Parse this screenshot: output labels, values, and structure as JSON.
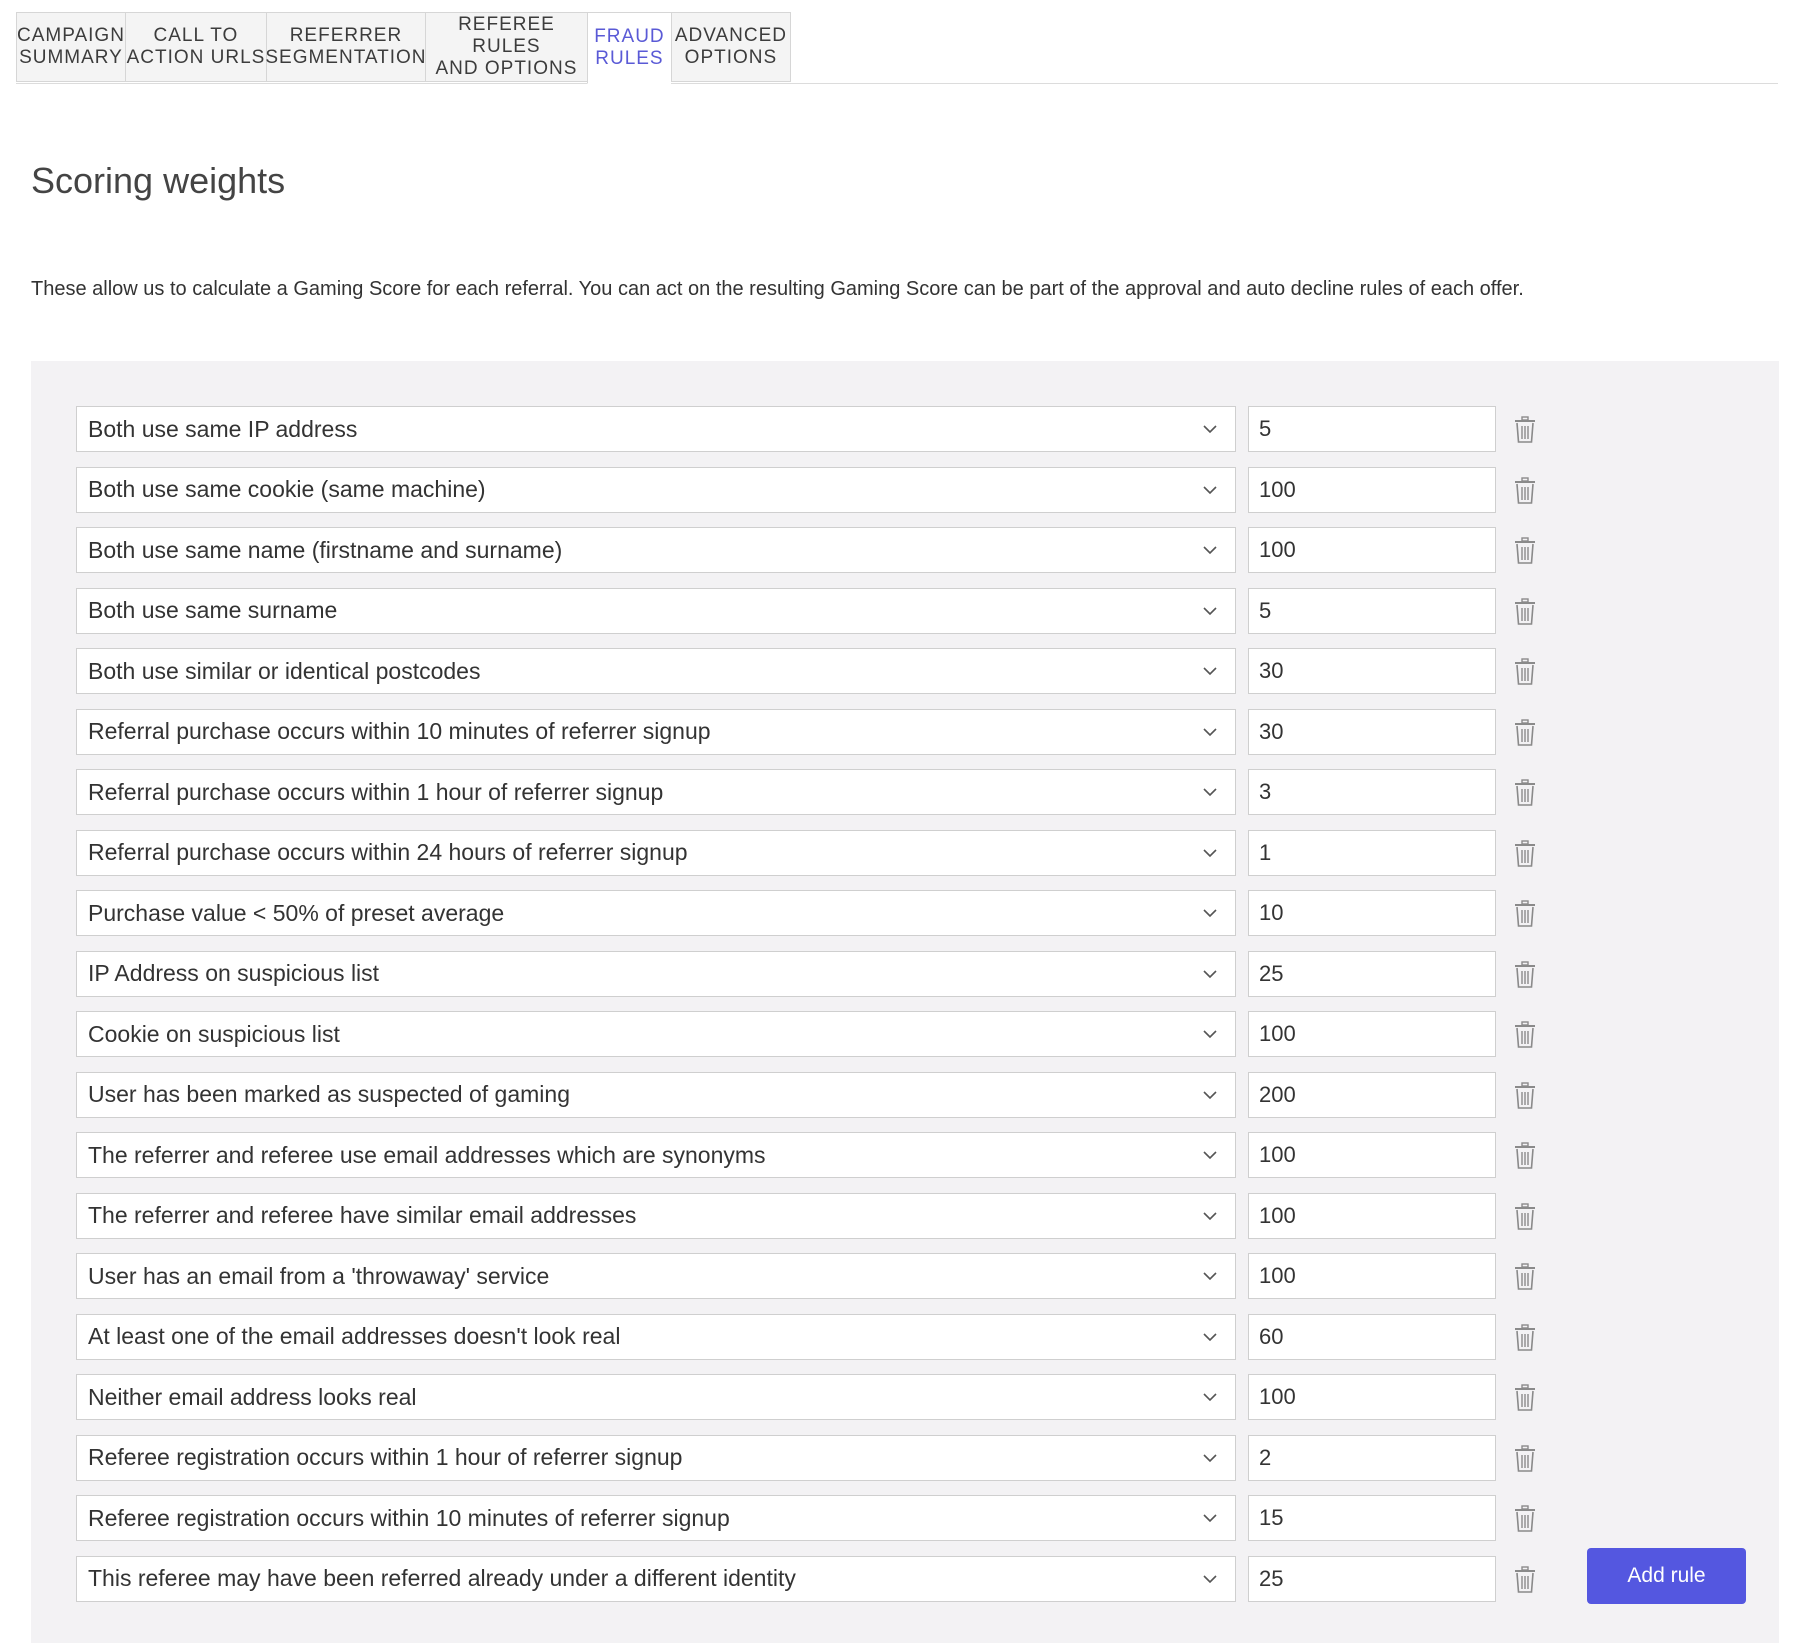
{
  "tabs": [
    {
      "label": "CAMPAIGN\nSUMMARY",
      "active": false
    },
    {
      "label": "CALL TO\nACTION URLS",
      "active": false
    },
    {
      "label": "REFERRER\nSEGMENTATION",
      "active": false
    },
    {
      "label": "REFEREE RULES\nAND OPTIONS",
      "active": false
    },
    {
      "label": "FRAUD\nRULES",
      "active": true
    },
    {
      "label": "ADVANCED\nOPTIONS",
      "active": false
    }
  ],
  "page": {
    "title": "Scoring weights",
    "description": "These allow us to calculate a Gaming Score for each referral. You can act on the resulting Gaming Score can be part of the approval and auto decline rules of each offer."
  },
  "rules": [
    {
      "label": "Both use same IP address",
      "weight": "5"
    },
    {
      "label": "Both use same cookie (same machine)",
      "weight": "100"
    },
    {
      "label": "Both use same name (firstname and surname)",
      "weight": "100"
    },
    {
      "label": "Both use same surname",
      "weight": "5"
    },
    {
      "label": "Both use similar or identical postcodes",
      "weight": "30"
    },
    {
      "label": "Referral purchase occurs within 10 minutes of referrer signup",
      "weight": "30"
    },
    {
      "label": "Referral purchase occurs within 1 hour of referrer signup",
      "weight": "3"
    },
    {
      "label": "Referral purchase occurs within 24 hours of referrer signup",
      "weight": "1"
    },
    {
      "label": "Purchase value < 50% of preset average",
      "weight": "10"
    },
    {
      "label": "IP Address on suspicious list",
      "weight": "25"
    },
    {
      "label": "Cookie on suspicious list",
      "weight": "100"
    },
    {
      "label": "User has been marked as suspected of gaming",
      "weight": "200"
    },
    {
      "label": "The referrer and referee use email addresses which are synonyms",
      "weight": "100"
    },
    {
      "label": "The referrer and referee have similar email addresses",
      "weight": "100"
    },
    {
      "label": "User has an email from a 'throwaway' service",
      "weight": "100"
    },
    {
      "label": "At least one of the email addresses doesn't look real",
      "weight": "60"
    },
    {
      "label": "Neither email address looks real",
      "weight": "100"
    },
    {
      "label": "Referee registration occurs within 1 hour of referrer signup",
      "weight": "2"
    },
    {
      "label": "Referee registration occurs within 10 minutes of referrer signup",
      "weight": "15"
    },
    {
      "label": "This referee may have been referred already under a different identity",
      "weight": "25"
    }
  ],
  "actions": {
    "add_rule_label": "Add rule"
  },
  "icons": {
    "dropdown": "chevron-down-icon",
    "delete": "trash-icon"
  },
  "colors": {
    "accent": "#5457e0",
    "active_tab_text": "#5a5ad6",
    "panel_background": "#f3f2f4"
  }
}
